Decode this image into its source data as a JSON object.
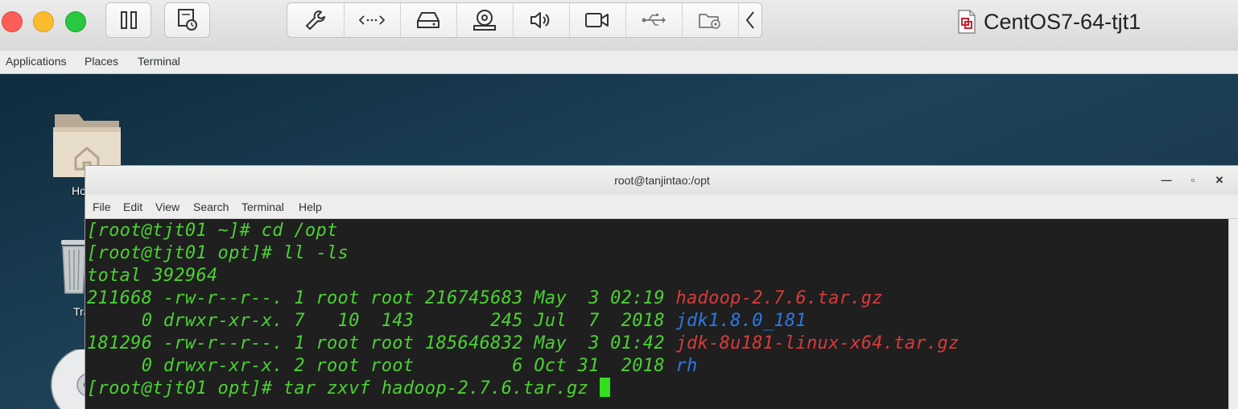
{
  "vm": {
    "title": "CentOS7-64-tjt1"
  },
  "toolbar": {
    "buttons": [
      "pause-icon",
      "snapshot-icon"
    ],
    "segments": [
      "wrench-icon",
      "network-icon",
      "hard-disk-icon",
      "cd-dvd-icon",
      "sound-icon",
      "camera-icon",
      "usb-icon",
      "shared-folder-icon"
    ],
    "collapse_icon": "chevron-left-icon"
  },
  "gnome": {
    "applications": "Applications",
    "places": "Places",
    "terminal": "Terminal"
  },
  "desktop": {
    "home_label": "Ho",
    "trash_label": "Tra"
  },
  "terminal": {
    "title": "root@tanjintao:/opt",
    "menu": {
      "file": "File",
      "edit": "Edit",
      "view": "View",
      "search": "Search",
      "terminal": "Terminal",
      "help": "Help"
    },
    "lines": {
      "l1": "[root@tjt01 ~]# cd /opt",
      "l2": "[root@tjt01 opt]# ll -ls",
      "l3": "total 392964",
      "l4_meta": "211668 -rw-r--r--. 1 root root 216745683 May  3 02:19 ",
      "l4_name": "hadoop-2.7.6.tar.gz",
      "l5_meta": "     0 drwxr-xr-x. 7   10  143       245 Jul  7  2018 ",
      "l5_name": "jdk1.8.0_181",
      "l6_meta": "181296 -rw-r--r--. 1 root root 185646832 May  3 01:42 ",
      "l6_name": "jdk-8u181-linux-x64.tar.gz",
      "l7_meta": "     0 drwxr-xr-x. 2 root root         6 Oct 31  2018 ",
      "l7_name": "rh",
      "l8": "[root@tjt01 opt]# tar zxvf hadoop-2.7.6.tar.gz "
    }
  },
  "colors": {
    "prompt_green": "#4bd132",
    "archive_red": "#d83a3a",
    "directory_blue": "#2d78e2",
    "terminal_bg": "#1f1f1f"
  }
}
